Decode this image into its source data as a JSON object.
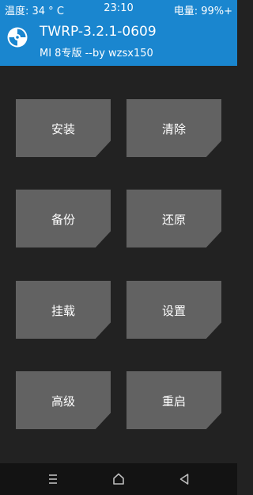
{
  "status_bar": {
    "temperature": "温度: 34 ° C",
    "time": "23:10",
    "battery": "电量: 99%+"
  },
  "header": {
    "title": "TWRP-3.2.1-0609",
    "subtitle": "MI 8专版 --by wzsx150",
    "logo_icon": "twrp-logo-icon",
    "background_color": "#1a86cf"
  },
  "menu": {
    "install": "安装",
    "wipe": "清除",
    "backup": "备份",
    "restore": "还原",
    "mount": "挂载",
    "settings": "设置",
    "advanced": "高级",
    "reboot": "重启"
  },
  "nav_bar": {
    "menu_icon": "menu-icon",
    "home_icon": "home-icon",
    "back_icon": "back-icon"
  }
}
